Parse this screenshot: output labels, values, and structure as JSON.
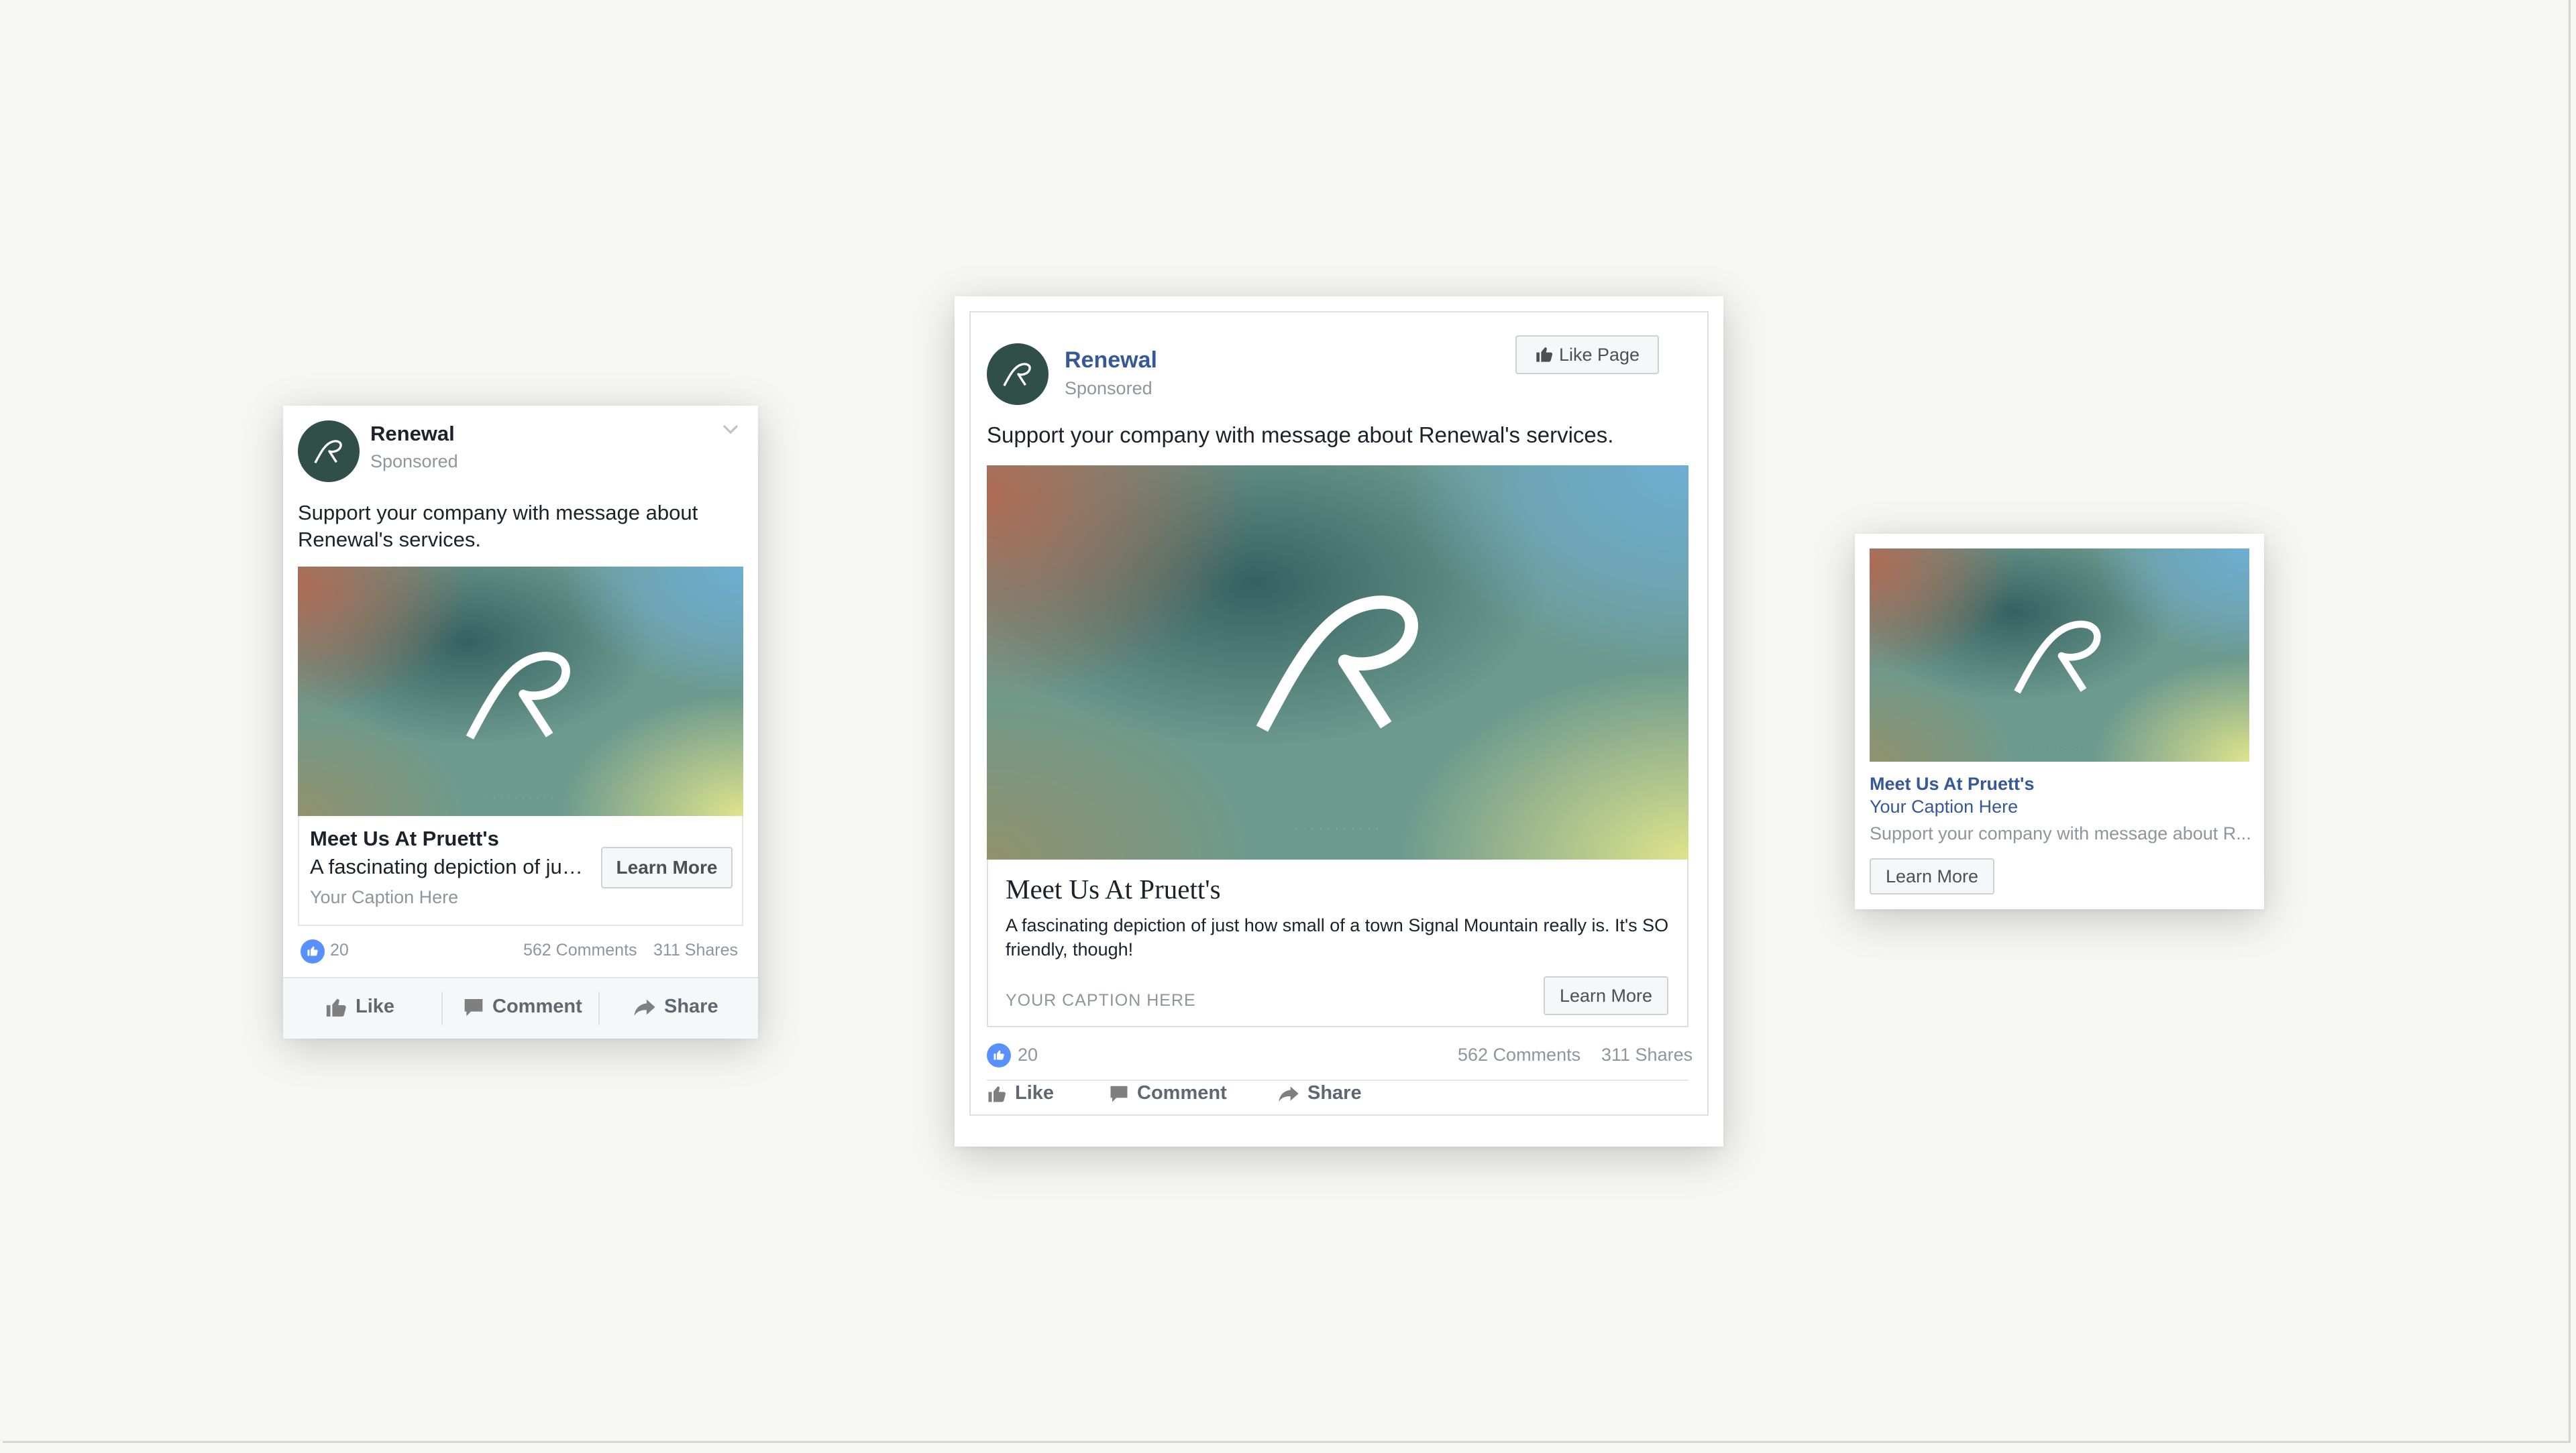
{
  "brand": {
    "name": "Renewal",
    "sponsored": "Sponsored"
  },
  "post_text": "Support your company with message about Renewal's services.",
  "mobile_ad": {
    "headline": "Meet Us At Pruett's",
    "description": "A fascinating depiction of ju…",
    "caption": "Your Caption Here",
    "cta": "Learn More",
    "likes": "20",
    "comments": "562 Comments",
    "shares": "311 Shares",
    "actions": {
      "like": "Like",
      "comment": "Comment",
      "share": "Share"
    }
  },
  "desktop_ad": {
    "like_page": "Like Page",
    "headline": "Meet Us At Pruett's",
    "description": "A fascinating depiction of just how small of a town Signal Mountain really is. It's SO friendly, though!",
    "caption": "YOUR CAPTION HERE",
    "cta": "Learn More",
    "likes": "20",
    "comments": "562 Comments",
    "shares": "311 Shares",
    "actions": {
      "like": "Like",
      "comment": "Comment",
      "share": "Share"
    }
  },
  "right_column_ad": {
    "headline": "Meet Us At Pruett's",
    "caption": "Your Caption Here",
    "description": "Support your company with message about R...",
    "cta": "Learn More"
  },
  "icons": [
    "renewal-logo-icon",
    "chevron-down-icon",
    "thumbs-up-icon",
    "comment-icon",
    "share-icon"
  ],
  "colors": {
    "link_blue": "#365899",
    "like_blue": "#5890ff",
    "avatar_green": "#2f4f48",
    "background": "#f6f7f5"
  }
}
